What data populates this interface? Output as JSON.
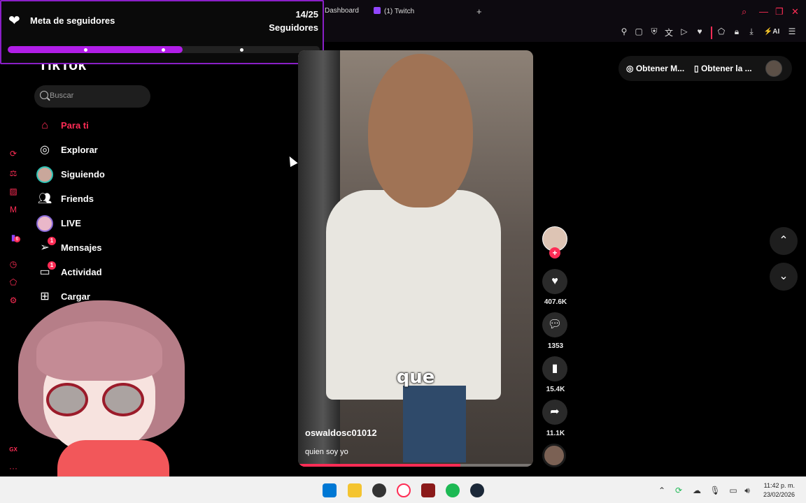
{
  "browser": {
    "tabs": [
      {
        "label": "Dashboard"
      },
      {
        "label": "(1) Twitch"
      }
    ],
    "new_tab": "+",
    "window_controls": {
      "search": "⌕",
      "minimize": "—",
      "restore": "❐",
      "close": "✕"
    },
    "toolbar_icons": [
      "pin-icon",
      "snapshot-icon",
      "shield-icon",
      "translate-icon",
      "play-icon",
      "heart-icon",
      "extensions-icon",
      "lock-icon",
      "download-icon",
      "ai-icon",
      "menu-icon"
    ],
    "toolbar_ai_label": "AI",
    "accent_color": "#ff2d55"
  },
  "sidestrip": {
    "icons": [
      "refresh-icon",
      "bag-icon",
      "cube-icon",
      "mail-icon",
      "twitch-icon",
      "history-icon",
      "extensions-icon",
      "settings-icon"
    ],
    "twitch_badge": "6",
    "bottom_label": "GX",
    "more": "···"
  },
  "follower_goal": {
    "title": "Meta de seguidores",
    "count": "14/25",
    "subtitle": "Seguidores",
    "progress": 0.56,
    "fill_color": "#b11ee8",
    "border_color": "#8a1fc7"
  },
  "tiktok": {
    "logo": "TikTok",
    "search_placeholder": "Buscar",
    "nav": [
      {
        "label": "Para ti",
        "icon": "home-icon",
        "active": true
      },
      {
        "label": "Explorar",
        "icon": "compass-icon"
      },
      {
        "label": "Siguiendo",
        "icon": "following-avatar-icon"
      },
      {
        "label": "Friends",
        "icon": "friends-icon"
      },
      {
        "label": "LIVE",
        "icon": "live-icon"
      },
      {
        "label": "Mensajes",
        "icon": "messages-icon",
        "badge": "1"
      },
      {
        "label": "Actividad",
        "icon": "activity-icon",
        "badge": "1"
      },
      {
        "label": "Cargar",
        "icon": "upload-icon"
      }
    ],
    "active_color": "#fe2c55"
  },
  "video": {
    "caption": "que",
    "username": "oswaldosc01012",
    "description": "quien soy yo",
    "progress": 0.69
  },
  "actions": {
    "follow_plus": "+",
    "likes": "407.6K",
    "comments": "1353",
    "saves": "15.4K",
    "shares": "11.1K"
  },
  "top_bar": {
    "item1": "Obtener M...",
    "item2": "Obtener la ..."
  },
  "taskbar": {
    "time": "11:42 p. m.",
    "date": "23/02/2026",
    "apps": [
      "windows-icon",
      "file-explorer-icon",
      "obs-icon",
      "opera-gx-icon",
      "vivaldi-icon",
      "spotify-icon",
      "steam-icon"
    ]
  }
}
